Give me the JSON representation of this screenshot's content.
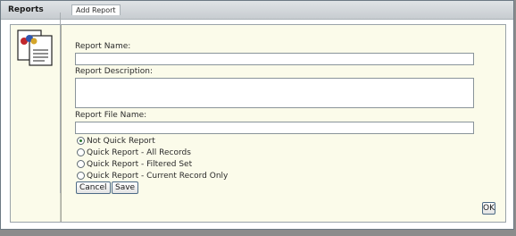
{
  "window": {
    "title": "Reports"
  },
  "tab": {
    "label": "Add Report"
  },
  "form": {
    "report_name_label": "Report Name:",
    "report_name_value": "",
    "report_description_label": "Report Description:",
    "report_description_value": "",
    "report_file_name_label": "Report File Name:",
    "report_file_name_value": ""
  },
  "options": [
    {
      "label": "Not Quick Report",
      "selected": true
    },
    {
      "label": "Quick Report - All Records",
      "selected": false
    },
    {
      "label": "Quick Report - Filtered Set",
      "selected": false
    },
    {
      "label": "Quick Report - Current Record Only",
      "selected": false
    }
  ],
  "buttons": {
    "cancel": "Cancel",
    "save": "Save",
    "ok": "OK"
  },
  "icons": {
    "reports": "reports-document-icon"
  }
}
